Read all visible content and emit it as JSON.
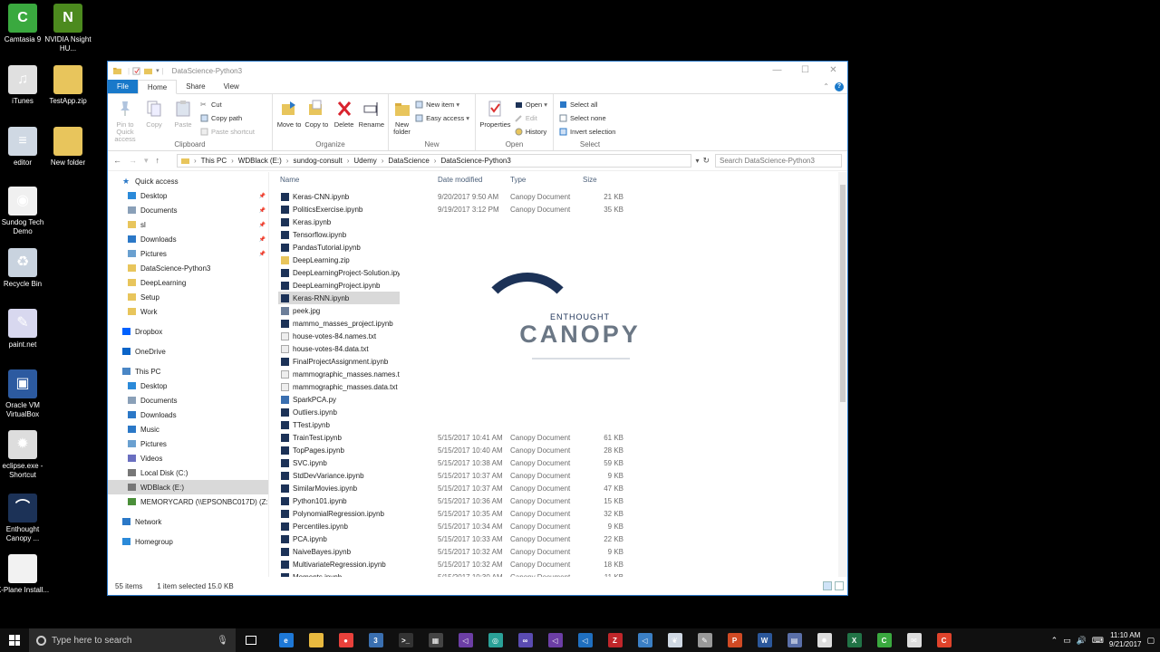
{
  "desktop": {
    "icons": [
      {
        "label": "Camtasia 9",
        "color": "#3aa93f",
        "glyph": "C"
      },
      {
        "label": "NVIDIA Nsight HU...",
        "color": "#4c8a1e",
        "glyph": "N"
      },
      {
        "label": "iTunes",
        "color": "#e0e0e0",
        "glyph": "♫"
      },
      {
        "label": "TestApp.zip",
        "color": "#e8c55c",
        "glyph": ""
      },
      {
        "label": "editor",
        "color": "#cfd8e3",
        "glyph": "≡"
      },
      {
        "label": "New folder",
        "color": "#e8c55c",
        "glyph": ""
      },
      {
        "label": "Sundog Tech Demo",
        "color": "#f0f0f0",
        "glyph": "◉"
      },
      {
        "label": "Recycle Bin",
        "color": "#c9d3df",
        "glyph": "♻"
      },
      {
        "label": "paint.net",
        "color": "#d8d8ef",
        "glyph": "✎"
      },
      {
        "label": "Oracle VM VirtualBox",
        "color": "#2c5aa0",
        "glyph": "▣"
      },
      {
        "label": "eclipse.exe - Shortcut",
        "color": "#ddd",
        "glyph": "✹"
      },
      {
        "label": "Enthought Canopy ...",
        "color": "#1c3257",
        "glyph": "⌒"
      },
      {
        "label": "X-Plane Install...",
        "color": "#f2f2f2",
        "glyph": ""
      }
    ]
  },
  "window": {
    "title": "DataScience-Python3",
    "tabs": {
      "file": "File",
      "home": "Home",
      "share": "Share",
      "view": "View"
    },
    "ribbon": {
      "clipboard": {
        "group": "Clipboard",
        "pin": "Pin to Quick access",
        "copy": "Copy",
        "paste": "Paste",
        "cut": "Cut",
        "copy_path": "Copy path",
        "paste_shortcut": "Paste shortcut"
      },
      "organize": {
        "group": "Organize",
        "move_to": "Move to",
        "copy_to": "Copy to",
        "delete": "Delete",
        "rename": "Rename"
      },
      "new": {
        "group": "New",
        "new_folder": "New folder",
        "new_item": "New item",
        "easy_access": "Easy access"
      },
      "open": {
        "group": "Open",
        "properties": "Properties",
        "open": "Open",
        "edit": "Edit",
        "history": "History"
      },
      "select": {
        "group": "Select",
        "select_all": "Select all",
        "select_none": "Select none",
        "invert": "Invert selection"
      }
    },
    "address": {
      "crumbs": [
        "This PC",
        "WDBlack (E:)",
        "sundog-consult",
        "Udemy",
        "DataScience",
        "DataScience-Python3"
      ],
      "search_placeholder": "Search DataScience-Python3"
    },
    "nav": [
      {
        "label": "Quick access",
        "icon": "star-icon",
        "indent": 0,
        "pin": false,
        "gap": false
      },
      {
        "label": "Desktop",
        "icon": "desktop-icon",
        "indent": 1,
        "pin": true
      },
      {
        "label": "Documents",
        "icon": "documents-icon",
        "indent": 1,
        "pin": true
      },
      {
        "label": "sl",
        "icon": "folder-icon",
        "indent": 1,
        "pin": true
      },
      {
        "label": "Downloads",
        "icon": "downloads-icon",
        "indent": 1,
        "pin": true
      },
      {
        "label": "Pictures",
        "icon": "pictures-icon",
        "indent": 1,
        "pin": true
      },
      {
        "label": "DataScience-Python3",
        "icon": "folder-icon",
        "indent": 1,
        "pin": false
      },
      {
        "label": "DeepLearning",
        "icon": "folder-icon",
        "indent": 1,
        "pin": false
      },
      {
        "label": "Setup",
        "icon": "folder-icon",
        "indent": 1,
        "pin": false
      },
      {
        "label": "Work",
        "icon": "folder-icon",
        "indent": 1,
        "pin": false
      },
      {
        "label": "Dropbox",
        "icon": "dropbox-icon",
        "indent": 0,
        "gap": true
      },
      {
        "label": "OneDrive",
        "icon": "onedrive-icon",
        "indent": 0,
        "gap": true
      },
      {
        "label": "This PC",
        "icon": "pc-icon",
        "indent": 0,
        "gap": true
      },
      {
        "label": "Desktop",
        "icon": "desktop-icon",
        "indent": 1
      },
      {
        "label": "Documents",
        "icon": "documents-icon",
        "indent": 1
      },
      {
        "label": "Downloads",
        "icon": "downloads-icon",
        "indent": 1
      },
      {
        "label": "Music",
        "icon": "music-icon",
        "indent": 1
      },
      {
        "label": "Pictures",
        "icon": "pictures-icon",
        "indent": 1
      },
      {
        "label": "Videos",
        "icon": "videos-icon",
        "indent": 1
      },
      {
        "label": "Local Disk (C:)",
        "icon": "drive-icon",
        "indent": 1
      },
      {
        "label": "WDBlack (E:)",
        "icon": "drive-icon",
        "indent": 1,
        "selected": true
      },
      {
        "label": "MEMORYCARD (\\\\EPSONBC017D) (Z:)",
        "icon": "network-drive-icon",
        "indent": 1
      },
      {
        "label": "Network",
        "icon": "network-icon",
        "indent": 0,
        "gap": true
      },
      {
        "label": "Homegroup",
        "icon": "homegroup-icon",
        "indent": 0,
        "gap": true
      }
    ],
    "columns": {
      "name": "Name",
      "date": "Date modified",
      "type": "Type",
      "size": "Size"
    },
    "files": [
      {
        "name": "Keras-CNN.ipynb",
        "date": "9/20/2017 9:50 AM",
        "type": "Canopy Document",
        "size": "21 KB",
        "icon": "canopy"
      },
      {
        "name": "PoliticsExercise.ipynb",
        "date": "9/19/2017 3:12 PM",
        "type": "Canopy Document",
        "size": "35 KB",
        "icon": "canopy"
      },
      {
        "name": "Keras.ipynb",
        "date": "",
        "type": "",
        "size": "",
        "icon": "canopy"
      },
      {
        "name": "Tensorflow.ipynb",
        "date": "",
        "type": "",
        "size": "",
        "icon": "canopy"
      },
      {
        "name": "PandasTutorial.ipynb",
        "date": "",
        "type": "",
        "size": "",
        "icon": "canopy"
      },
      {
        "name": "DeepLearning.zip",
        "date": "",
        "type": "",
        "size": "",
        "icon": "zip"
      },
      {
        "name": "DeepLearningProject-Solution.ipynb",
        "date": "",
        "type": "",
        "size": "",
        "icon": "canopy"
      },
      {
        "name": "DeepLearningProject.ipynb",
        "date": "",
        "type": "",
        "size": "",
        "icon": "canopy"
      },
      {
        "name": "Keras-RNN.ipynb",
        "date": "",
        "type": "",
        "size": "",
        "icon": "canopy",
        "selected": true
      },
      {
        "name": "peek.jpg",
        "date": "",
        "type": "",
        "size": "",
        "icon": "image"
      },
      {
        "name": "mammo_masses_project.ipynb",
        "date": "",
        "type": "",
        "size": "",
        "icon": "canopy"
      },
      {
        "name": "house-votes-84.names.txt",
        "date": "",
        "type": "",
        "size": "",
        "icon": "text"
      },
      {
        "name": "house-votes-84.data.txt",
        "date": "",
        "type": "",
        "size": "",
        "icon": "text"
      },
      {
        "name": "FinalProjectAssignment.ipynb",
        "date": "",
        "type": "",
        "size": "",
        "icon": "canopy"
      },
      {
        "name": "mammographic_masses.names.txt",
        "date": "",
        "type": "",
        "size": "",
        "icon": "text"
      },
      {
        "name": "mammographic_masses.data.txt",
        "date": "",
        "type": "",
        "size": "",
        "icon": "text"
      },
      {
        "name": "SparkPCA.py",
        "date": "",
        "type": "",
        "size": "",
        "icon": "python"
      },
      {
        "name": "Outliers.ipynb",
        "date": "",
        "type": "",
        "size": "",
        "icon": "canopy"
      },
      {
        "name": "TTest.ipynb",
        "date": "",
        "type": "",
        "size": "",
        "icon": "canopy"
      },
      {
        "name": "TrainTest.ipynb",
        "date": "5/15/2017 10:41 AM",
        "type": "Canopy Document",
        "size": "61 KB",
        "icon": "canopy"
      },
      {
        "name": "TopPages.ipynb",
        "date": "5/15/2017 10:40 AM",
        "type": "Canopy Document",
        "size": "28 KB",
        "icon": "canopy"
      },
      {
        "name": "SVC.ipynb",
        "date": "5/15/2017 10:38 AM",
        "type": "Canopy Document",
        "size": "59 KB",
        "icon": "canopy"
      },
      {
        "name": "StdDevVariance.ipynb",
        "date": "5/15/2017 10:37 AM",
        "type": "Canopy Document",
        "size": "9 KB",
        "icon": "canopy"
      },
      {
        "name": "SimilarMovies.ipynb",
        "date": "5/15/2017 10:37 AM",
        "type": "Canopy Document",
        "size": "47 KB",
        "icon": "canopy"
      },
      {
        "name": "Python101.ipynb",
        "date": "5/15/2017 10:36 AM",
        "type": "Canopy Document",
        "size": "15 KB",
        "icon": "canopy"
      },
      {
        "name": "PolynomialRegression.ipynb",
        "date": "5/15/2017 10:35 AM",
        "type": "Canopy Document",
        "size": "32 KB",
        "icon": "canopy"
      },
      {
        "name": "Percentiles.ipynb",
        "date": "5/15/2017 10:34 AM",
        "type": "Canopy Document",
        "size": "9 KB",
        "icon": "canopy"
      },
      {
        "name": "PCA.ipynb",
        "date": "5/15/2017 10:33 AM",
        "type": "Canopy Document",
        "size": "22 KB",
        "icon": "canopy"
      },
      {
        "name": "NaiveBayes.ipynb",
        "date": "5/15/2017 10:32 AM",
        "type": "Canopy Document",
        "size": "9 KB",
        "icon": "canopy"
      },
      {
        "name": "MultivariateRegression.ipynb",
        "date": "5/15/2017 10:32 AM",
        "type": "Canopy Document",
        "size": "18 KB",
        "icon": "canopy"
      },
      {
        "name": "Moments.ipynb",
        "date": "5/15/2017 10:30 AM",
        "type": "Canopy Document",
        "size": "11 KB",
        "icon": "canopy"
      }
    ],
    "status": {
      "count": "55 items",
      "selection": "1 item selected  15.0 KB"
    }
  },
  "splash": {
    "sub": "ENTHOUGHT",
    "main": "CANOPY"
  },
  "taskbar": {
    "search_placeholder": "Type here to search",
    "apps": [
      {
        "name": "edge",
        "color": "#1e78d6",
        "glyph": "e"
      },
      {
        "name": "file-explorer",
        "color": "#e8b93f",
        "glyph": ""
      },
      {
        "name": "chrome",
        "color": "#e9413b",
        "glyph": "●"
      },
      {
        "name": "app-3d",
        "color": "#3a6fb0",
        "glyph": "3"
      },
      {
        "name": "terminal",
        "color": "#333",
        "glyph": ">_"
      },
      {
        "name": "calculator",
        "color": "#444",
        "glyph": "▦"
      },
      {
        "name": "visual-studio",
        "color": "#6c3ea5",
        "glyph": "◁"
      },
      {
        "name": "globe",
        "color": "#2aa198",
        "glyph": "◎"
      },
      {
        "name": "infinity",
        "color": "#5a4bb0",
        "glyph": "∞"
      },
      {
        "name": "visual-studio-2",
        "color": "#6c3ea5",
        "glyph": "◁"
      },
      {
        "name": "vscode",
        "color": "#1f6fbf",
        "glyph": "◁"
      },
      {
        "name": "filezilla",
        "color": "#c0262a",
        "glyph": "Z"
      },
      {
        "name": "visual-studio-code",
        "color": "#3b7fc4",
        "glyph": "◁"
      },
      {
        "name": "feather",
        "color": "#cfd8e3",
        "glyph": "❦"
      },
      {
        "name": "tools",
        "color": "#999",
        "glyph": "✎"
      },
      {
        "name": "powerpoint",
        "color": "#d04a24",
        "glyph": "P"
      },
      {
        "name": "word",
        "color": "#2b579a",
        "glyph": "W"
      },
      {
        "name": "monitor",
        "color": "#5a6fa8",
        "glyph": "▤"
      },
      {
        "name": "eclipse",
        "color": "#ddd",
        "glyph": "✹"
      },
      {
        "name": "excel",
        "color": "#217346",
        "glyph": "X"
      },
      {
        "name": "camtasia",
        "color": "#3aa93f",
        "glyph": "C"
      },
      {
        "name": "mail",
        "color": "#ddd",
        "glyph": "✉"
      },
      {
        "name": "camtasia-recorder",
        "color": "#e0432b",
        "glyph": "C"
      }
    ],
    "time": "11:10 AM",
    "date": "9/21/2017"
  }
}
